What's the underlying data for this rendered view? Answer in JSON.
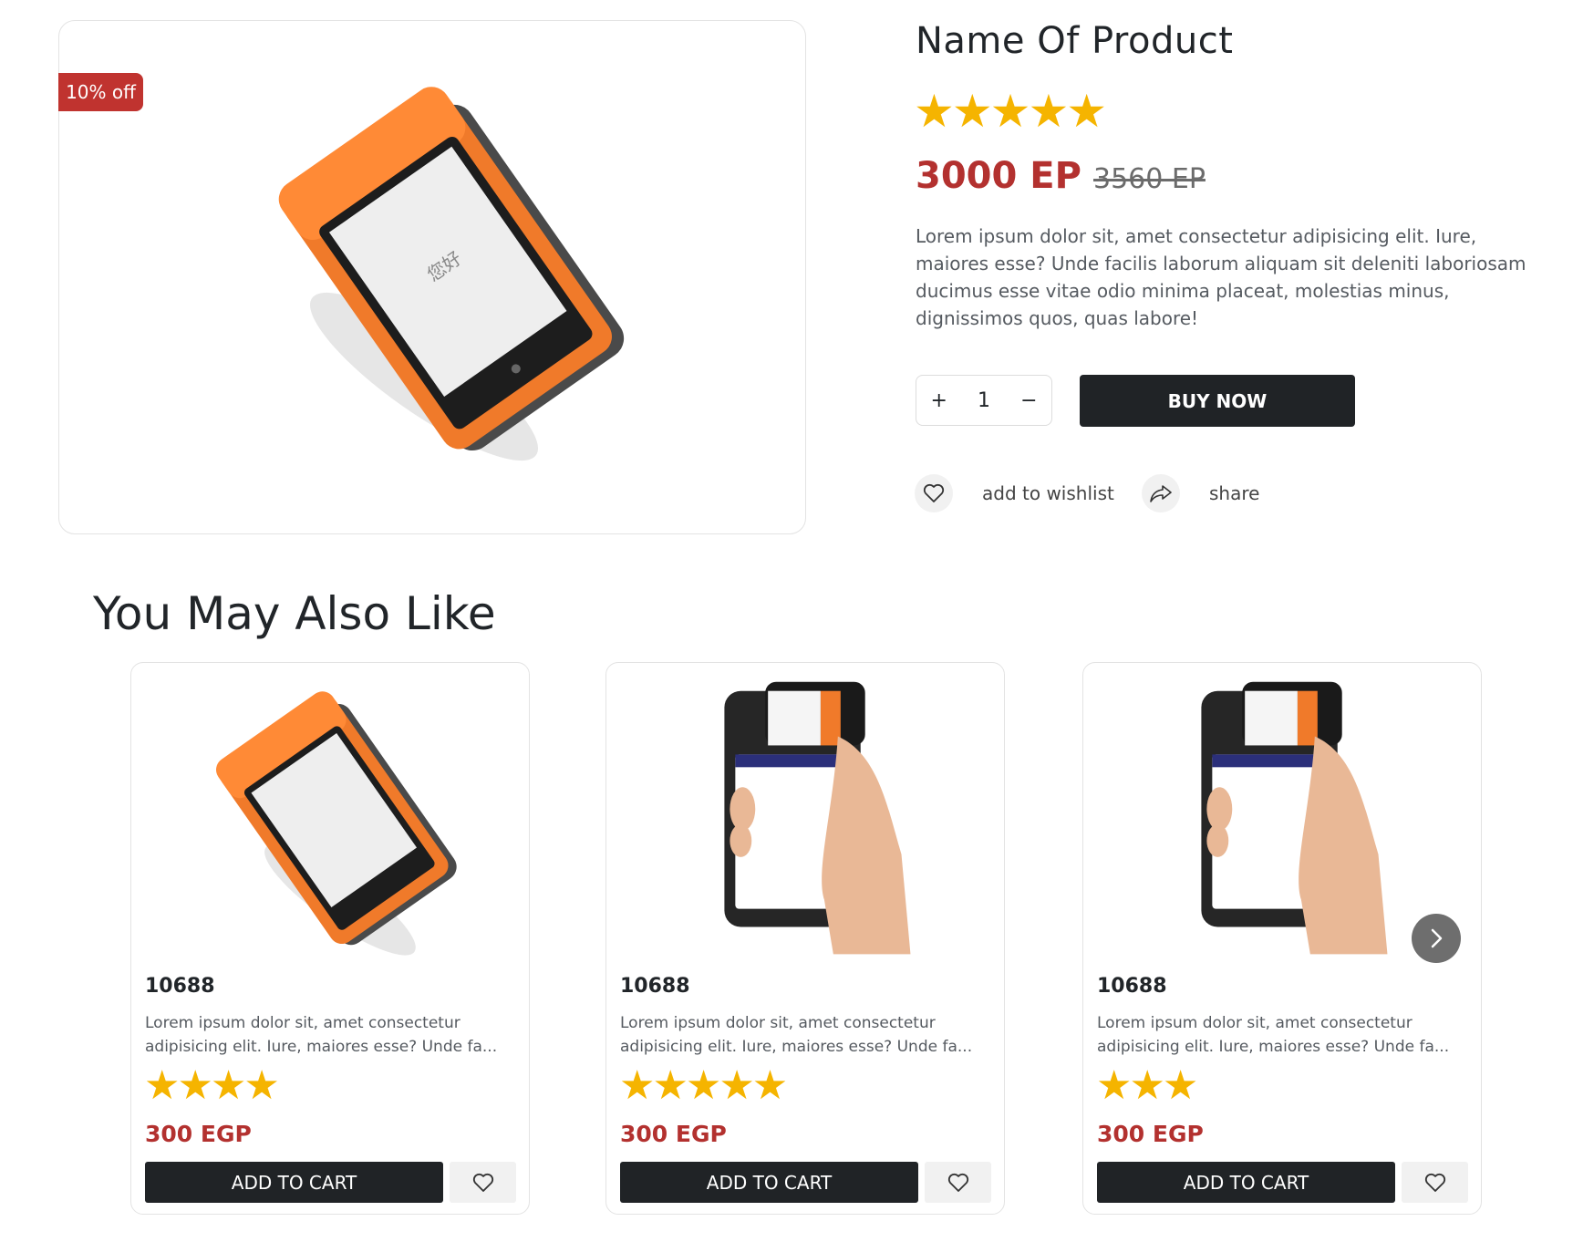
{
  "product": {
    "name": "Name Of Product",
    "discount_badge": "10% off",
    "rating_stars": "★★★★★",
    "price": "3000 EP",
    "old_price": "3560 EP",
    "description": "Lorem ipsum dolor sit, amet consectetur adipisicing elit. Iure, maiores esse? Unde facilis laborum aliquam sit deleniti laboriosam ducimus esse vitae odio minima placeat, molestias minus, dignissimos quos, quas labore!",
    "quantity": {
      "increment_label": "+",
      "value": "1",
      "decrement_label": "−"
    },
    "buy_now_label": "BUY NOW",
    "wishlist_label": "add to wishlist",
    "share_label": "share",
    "screen_text": "您好"
  },
  "related": {
    "title": "You May Also Like",
    "items": [
      {
        "code": "10688",
        "description": "Lorem ipsum dolor sit, amet consectetur\nadipisicing elit. Iure, maiores esse? Unde fa...",
        "stars": "★★★★",
        "rating": 4,
        "price": "300 EGP",
        "cart_label": "ADD TO CART",
        "image": "orange-pos-terminal"
      },
      {
        "code": "10688",
        "description": "Lorem ipsum dolor sit, amet consectetur\nadipisicing elit. Iure, maiores esse? Unde fa...",
        "stars": "★★★★★",
        "rating": 5,
        "price": "300 EGP",
        "cart_label": "ADD TO CART",
        "image": "handheld-pos-terminal"
      },
      {
        "code": "10688",
        "description": "Lorem ipsum dolor sit, amet consectetur\nadipisicing elit. Iure, maiores esse? Unde fa...",
        "stars": "★★★",
        "rating": 3,
        "price": "300 EGP",
        "cart_label": "ADD TO CART",
        "image": "handheld-pos-terminal"
      }
    ]
  },
  "colors": {
    "accent_red": "#b3312f",
    "star": "#f5b400",
    "dark_button": "#202326"
  }
}
